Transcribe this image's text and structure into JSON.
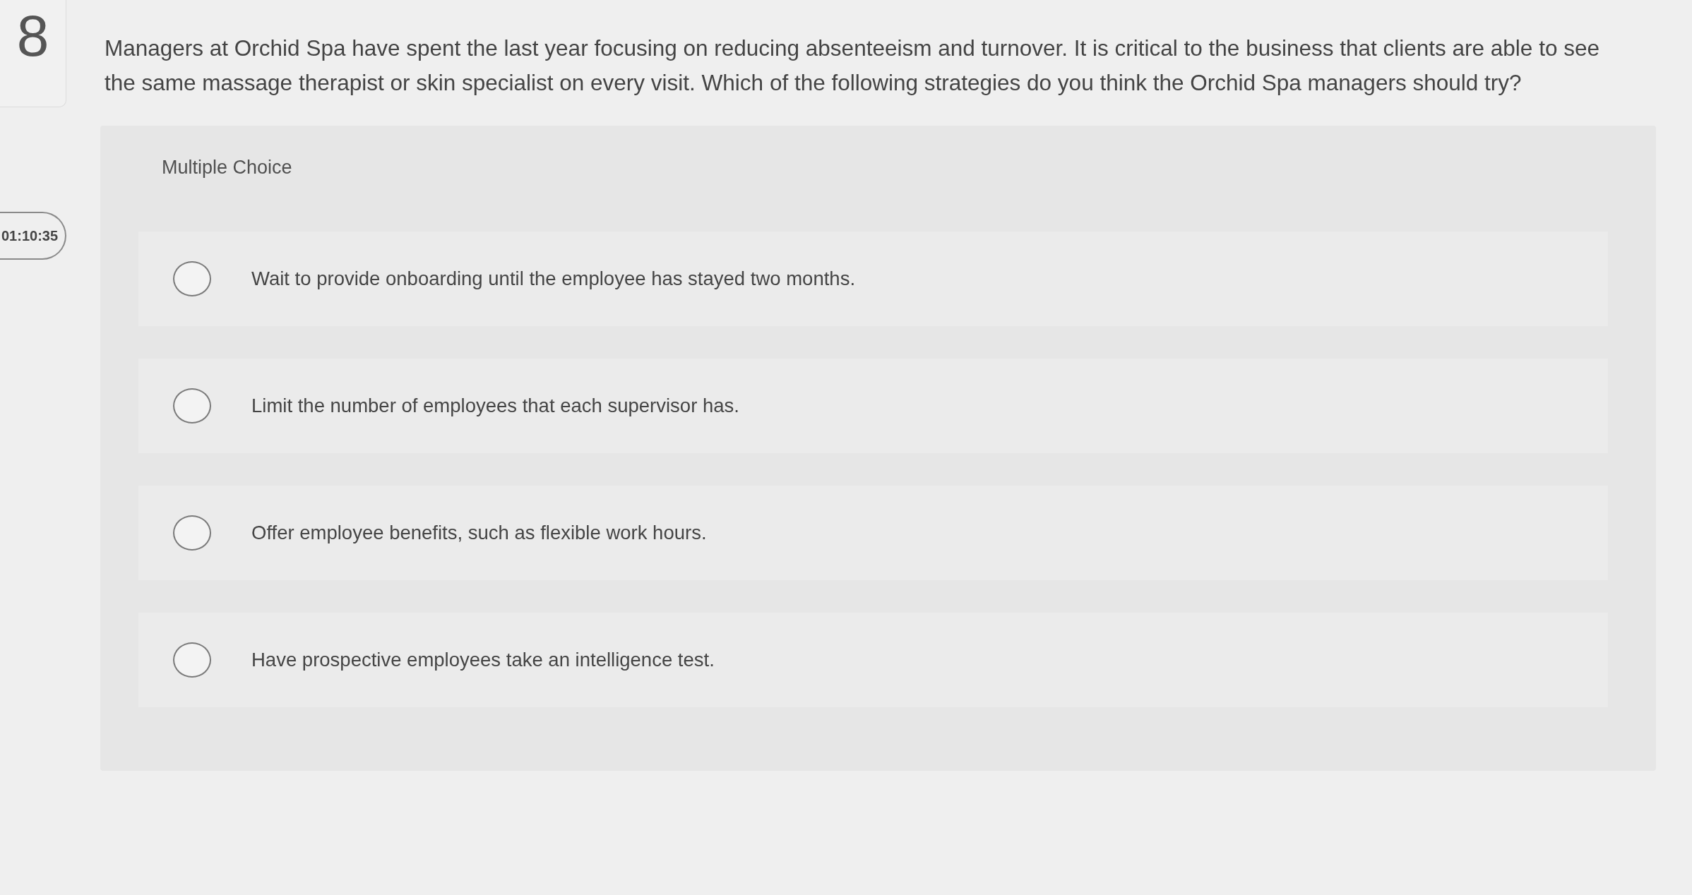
{
  "question_number": "8",
  "timer": "01:10:35",
  "question": "Managers at Orchid Spa have spent the last year focusing on reducing absenteeism and turnover. It is critical to the business that clients are able to see the same massage therapist or skin specialist on every visit. Which of the following strategies do you think the Orchid Spa managers should try?",
  "answer_panel": {
    "label": "Multiple Choice",
    "options": [
      {
        "text": "Wait to provide onboarding until the employee has stayed two months.",
        "selected": false
      },
      {
        "text": "Limit the number of employees that each supervisor has.",
        "selected": false
      },
      {
        "text": "Offer employee benefits, such as flexible work hours.",
        "selected": false
      },
      {
        "text": "Have prospective employees take an intelligence test.",
        "selected": false
      }
    ]
  }
}
